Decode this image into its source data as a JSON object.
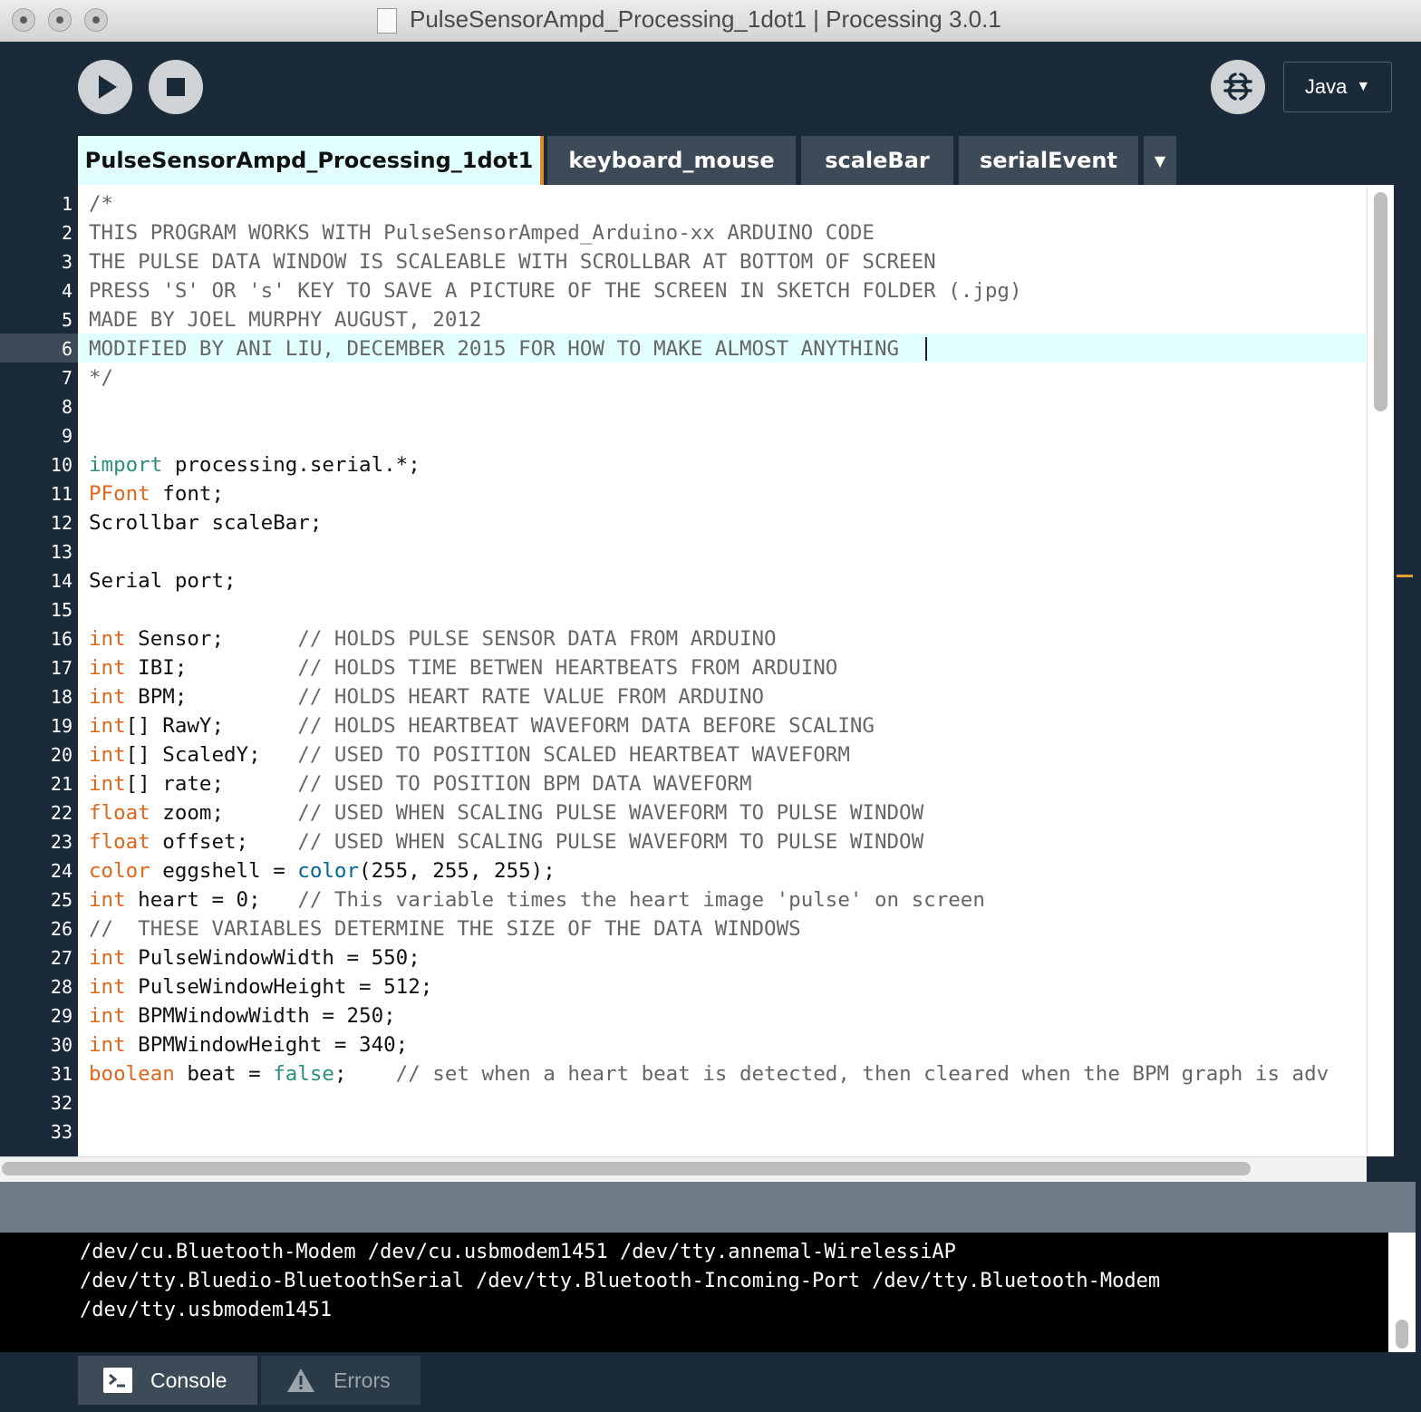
{
  "window": {
    "title": "PulseSensorAmpd_Processing_1dot1 | Processing 3.0.1"
  },
  "toolbar": {
    "run_icon": "play-icon",
    "stop_icon": "stop-icon",
    "debug_icon": "debugger-icon",
    "mode": "Java",
    "mode_arrow": "▼"
  },
  "tabs": [
    {
      "label": "PulseSensorAmpd_Processing_1dot1",
      "active": true
    },
    {
      "label": "keyboard_mouse"
    },
    {
      "label": "scaleBar"
    },
    {
      "label": "serialEvent"
    }
  ],
  "tabs_menu": "▼",
  "editor": {
    "current_line": 6,
    "lines": [
      {
        "n": "1",
        "segments": [
          {
            "t": "/*",
            "c": "cm"
          }
        ]
      },
      {
        "n": "2",
        "segments": [
          {
            "t": "THIS PROGRAM WORKS WITH PulseSensorAmped_Arduino-xx ARDUINO CODE",
            "c": "cm"
          }
        ]
      },
      {
        "n": "3",
        "segments": [
          {
            "t": "THE PULSE DATA WINDOW IS SCALEABLE WITH SCROLLBAR AT BOTTOM OF SCREEN",
            "c": "cm"
          }
        ]
      },
      {
        "n": "4",
        "segments": [
          {
            "t": "PRESS 'S' OR 's' KEY TO SAVE A PICTURE OF THE SCREEN IN SKETCH FOLDER (.jpg)",
            "c": "cm"
          }
        ]
      },
      {
        "n": "5",
        "segments": [
          {
            "t": "MADE BY JOEL MURPHY AUGUST, 2012",
            "c": "cm"
          }
        ]
      },
      {
        "n": "6",
        "segments": [
          {
            "t": "MODIFIED BY ANI LIU, DECEMBER 2015 FOR HOW TO MAKE ALMOST ANYTHING",
            "c": "cm"
          }
        ]
      },
      {
        "n": "7",
        "segments": [
          {
            "t": "*/",
            "c": "cm"
          }
        ]
      },
      {
        "n": "8",
        "segments": []
      },
      {
        "n": "9",
        "segments": []
      },
      {
        "n": "10",
        "segments": [
          {
            "t": "import",
            "c": "kw"
          },
          {
            "t": " processing.serial.*;",
            "c": ""
          }
        ]
      },
      {
        "n": "11",
        "segments": [
          {
            "t": "PFont",
            "c": "ty"
          },
          {
            "t": " font;",
            "c": ""
          }
        ]
      },
      {
        "n": "12",
        "segments": [
          {
            "t": "Scrollbar scaleBar;",
            "c": ""
          }
        ]
      },
      {
        "n": "13",
        "segments": []
      },
      {
        "n": "14",
        "segments": [
          {
            "t": "Serial port;",
            "c": ""
          }
        ]
      },
      {
        "n": "15",
        "segments": []
      },
      {
        "n": "16",
        "segments": [
          {
            "t": "int",
            "c": "ty"
          },
          {
            "t": " Sensor;      ",
            "c": ""
          },
          {
            "t": "// HOLDS PULSE SENSOR DATA FROM ARDUINO",
            "c": "cm"
          }
        ]
      },
      {
        "n": "17",
        "segments": [
          {
            "t": "int",
            "c": "ty"
          },
          {
            "t": " IBI;         ",
            "c": ""
          },
          {
            "t": "// HOLDS TIME BETWEN HEARTBEATS FROM ARDUINO",
            "c": "cm"
          }
        ]
      },
      {
        "n": "18",
        "segments": [
          {
            "t": "int",
            "c": "ty"
          },
          {
            "t": " BPM;         ",
            "c": ""
          },
          {
            "t": "// HOLDS HEART RATE VALUE FROM ARDUINO",
            "c": "cm"
          }
        ]
      },
      {
        "n": "19",
        "segments": [
          {
            "t": "int",
            "c": "ty"
          },
          {
            "t": "[] RawY;      ",
            "c": ""
          },
          {
            "t": "// HOLDS HEARTBEAT WAVEFORM DATA BEFORE SCALING",
            "c": "cm"
          }
        ]
      },
      {
        "n": "20",
        "segments": [
          {
            "t": "int",
            "c": "ty"
          },
          {
            "t": "[] ScaledY;   ",
            "c": ""
          },
          {
            "t": "// USED TO POSITION SCALED HEARTBEAT WAVEFORM",
            "c": "cm"
          }
        ]
      },
      {
        "n": "21",
        "segments": [
          {
            "t": "int",
            "c": "ty"
          },
          {
            "t": "[] rate;      ",
            "c": ""
          },
          {
            "t": "// USED TO POSITION BPM DATA WAVEFORM",
            "c": "cm"
          }
        ]
      },
      {
        "n": "22",
        "segments": [
          {
            "t": "float",
            "c": "ty"
          },
          {
            "t": " zoom;      ",
            "c": ""
          },
          {
            "t": "// USED WHEN SCALING PULSE WAVEFORM TO PULSE WINDOW",
            "c": "cm"
          }
        ]
      },
      {
        "n": "23",
        "segments": [
          {
            "t": "float",
            "c": "ty"
          },
          {
            "t": " offset;    ",
            "c": ""
          },
          {
            "t": "// USED WHEN SCALING PULSE WAVEFORM TO PULSE WINDOW",
            "c": "cm"
          }
        ]
      },
      {
        "n": "24",
        "segments": [
          {
            "t": "color",
            "c": "ty"
          },
          {
            "t": " eggshell = ",
            "c": ""
          },
          {
            "t": "color",
            "c": "fn"
          },
          {
            "t": "(255, 255, 255);",
            "c": ""
          }
        ]
      },
      {
        "n": "25",
        "segments": [
          {
            "t": "int",
            "c": "ty"
          },
          {
            "t": " heart = 0;   ",
            "c": ""
          },
          {
            "t": "// This variable times the heart image 'pulse' on screen",
            "c": "cm"
          }
        ]
      },
      {
        "n": "26",
        "segments": [
          {
            "t": "//  THESE VARIABLES DETERMINE THE SIZE OF THE DATA WINDOWS",
            "c": "cm"
          }
        ]
      },
      {
        "n": "27",
        "segments": [
          {
            "t": "int",
            "c": "ty"
          },
          {
            "t": " PulseWindowWidth = 550;",
            "c": ""
          }
        ]
      },
      {
        "n": "28",
        "segments": [
          {
            "t": "int",
            "c": "ty"
          },
          {
            "t": " PulseWindowHeight = 512;",
            "c": ""
          }
        ]
      },
      {
        "n": "29",
        "segments": [
          {
            "t": "int",
            "c": "ty"
          },
          {
            "t": " BPMWindowWidth = 250;",
            "c": ""
          }
        ]
      },
      {
        "n": "30",
        "segments": [
          {
            "t": "int",
            "c": "ty"
          },
          {
            "t": " BPMWindowHeight = 340;",
            "c": ""
          }
        ]
      },
      {
        "n": "31",
        "segments": [
          {
            "t": "boolean",
            "c": "ty"
          },
          {
            "t": " beat = ",
            "c": ""
          },
          {
            "t": "false",
            "c": "lit"
          },
          {
            "t": ";    ",
            "c": ""
          },
          {
            "t": "// set when a heart beat is detected, then cleared when the BPM graph is adv",
            "c": "cm"
          }
        ]
      },
      {
        "n": "32",
        "segments": []
      },
      {
        "n": "33",
        "segments": []
      }
    ]
  },
  "console": {
    "lines": [
      "/dev/cu.Bluetooth-Modem /dev/cu.usbmodem1451 /dev/tty.annemal-WirelessiAP",
      "/dev/tty.Bluedio-BluetoothSerial /dev/tty.Bluetooth-Incoming-Port /dev/tty.Bluetooth-Modem",
      "/dev/tty.usbmodem1451"
    ]
  },
  "footer": {
    "console_label": "Console",
    "console_icon": "terminal-icon",
    "errors_label": "Errors",
    "errors_icon": "warning-icon"
  },
  "colors": {
    "background": "#1b2a38",
    "active_tab": "#e0fffd",
    "inactive_tab": "#3c4b57",
    "keyword": "#2a8f7d",
    "type": "#e2661a",
    "comment": "#666666"
  }
}
